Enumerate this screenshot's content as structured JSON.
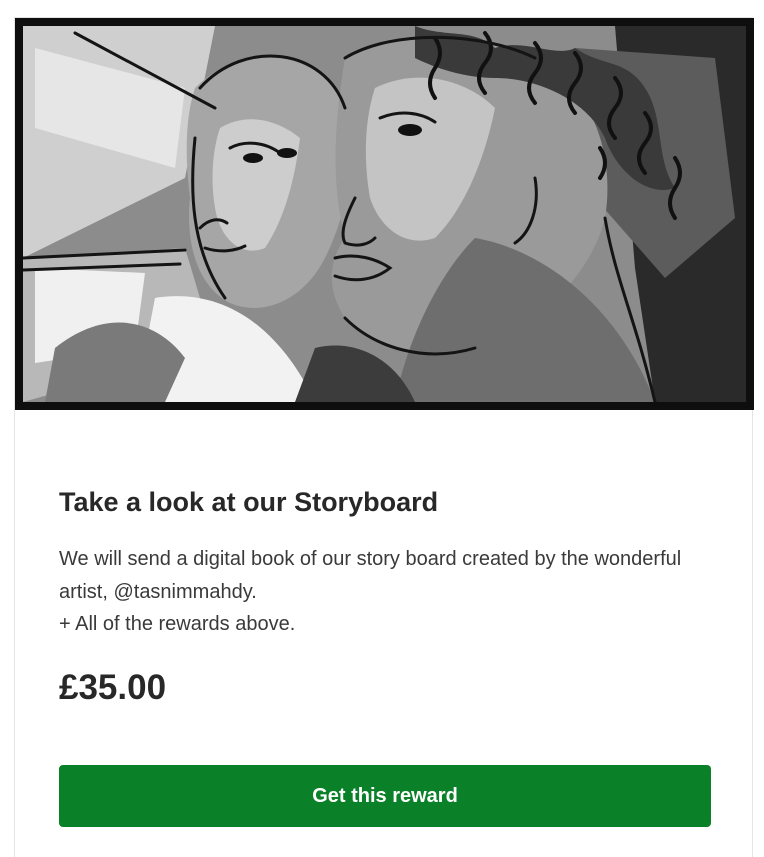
{
  "reward": {
    "title": "Take a look at our Storyboard",
    "description_lines": [
      "We will send a digital book of our story board created by the wonderful artist, @tasnimmahdy.",
      "+ All of the rewards above."
    ],
    "price": "£35.00",
    "button_label": "Get this reward"
  },
  "image": {
    "subject": "grayscale storyboard sketch of two faces",
    "accent_color": "#0a8028"
  }
}
